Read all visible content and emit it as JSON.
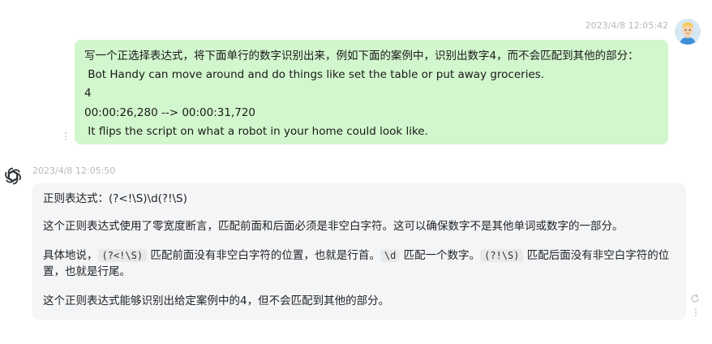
{
  "user_message": {
    "timestamp": "2023/4/8 12:05:42",
    "lines": [
      "写一个正选择表达式，将下面单行的数字识别出来，例如下面的案例中，识别出数字4，而不会匹配到其他的部分：",
      " Bot Handy can move around and do things like set the table or put away groceries.",
      "4",
      "00:00:26,280 --> 00:00:31,720",
      " It flips the script on what a robot in your home could look like."
    ]
  },
  "bot_message": {
    "timestamp": "2023/4/8 12:05:50",
    "p1": "正则表达式：(?<!\\S)\\d(?!\\S)",
    "p2": "这个正则表达式使用了零宽度断言，匹配前面和后面必须是非空白字符。这可以确保数字不是其他单词或数字的一部分。",
    "p3": {
      "t1": "具体地说，",
      "c1": "(?<!\\S)",
      "t2": " 匹配前面没有非空白字符的位置，也就是行首。",
      "c2": "\\d",
      "t3": " 匹配一个数字。",
      "c3": "(?!\\S)",
      "t4": " 匹配后面没有非空白字符的位置，也就是行尾。"
    },
    "p4": "这个正则表达式能够识别出给定案例中的4，但不会匹配到其他的部分。"
  },
  "icons": {
    "user_avatar": "user-avatar",
    "bot_avatar": "openai-logo-icon",
    "regenerate": "refresh-icon",
    "more": "more-vertical-icon"
  },
  "colors": {
    "user_bubble": "#d2f6cd",
    "bot_bubble": "#f4f5f6",
    "timestamp": "#b7b9bd"
  }
}
